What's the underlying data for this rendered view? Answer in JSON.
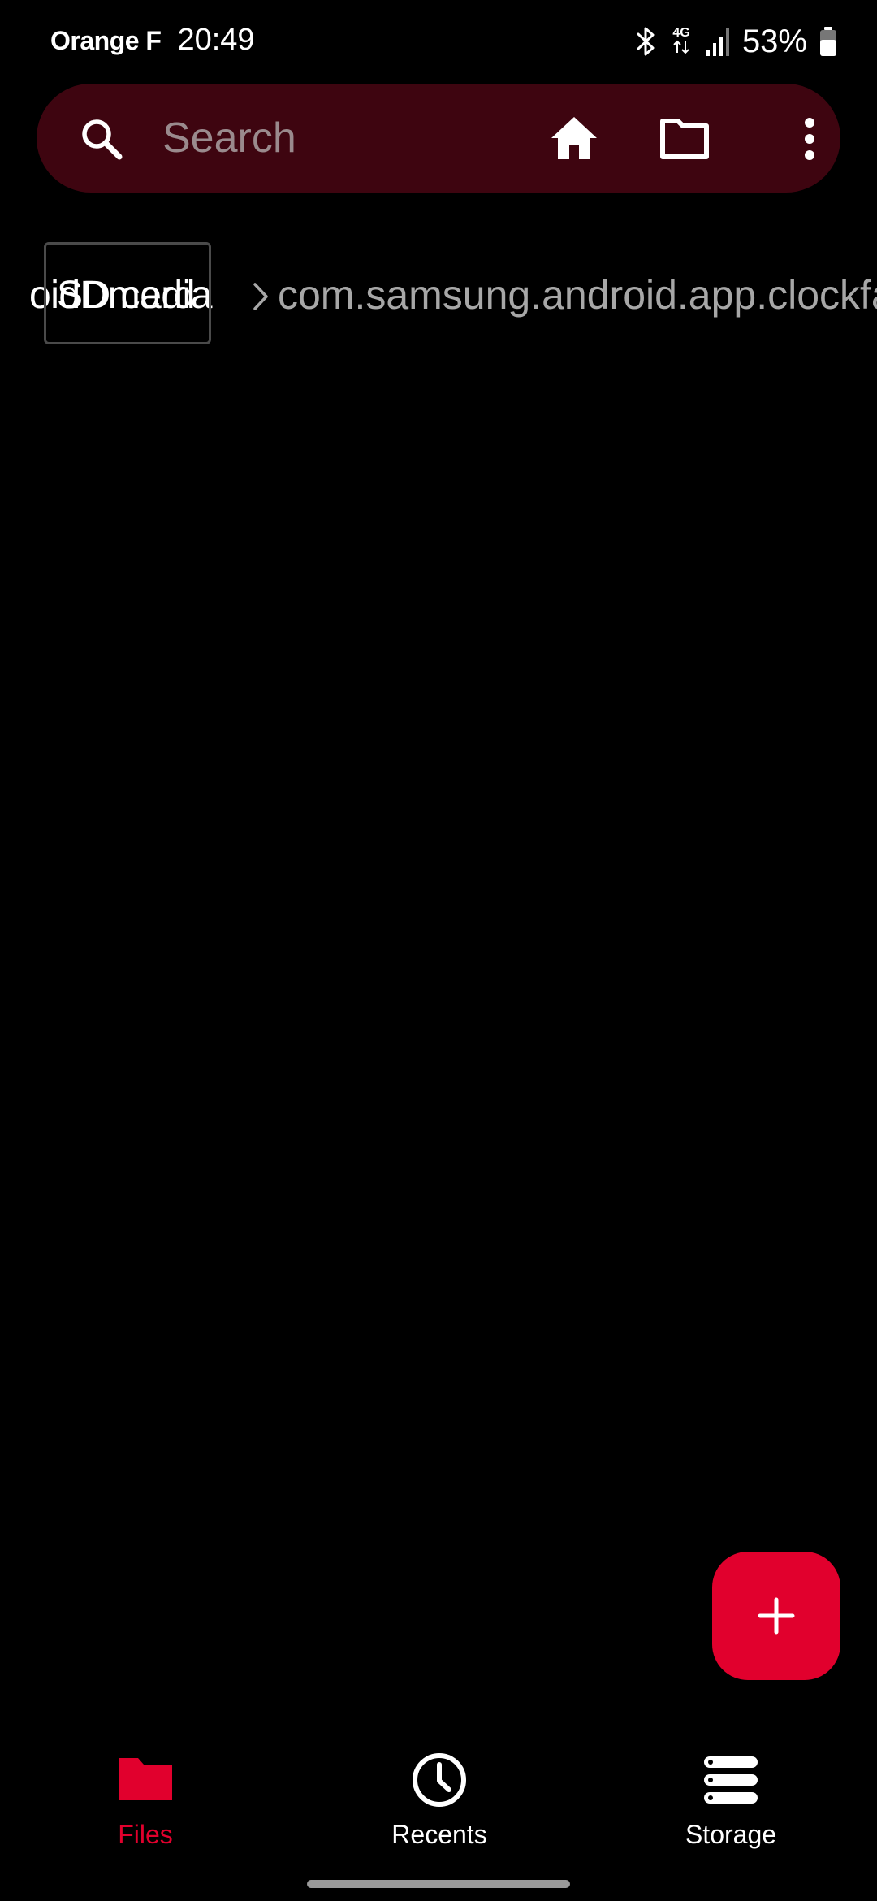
{
  "status_bar": {
    "carrier": "Orange F",
    "time": "20:49",
    "network": "4G",
    "battery": "53%",
    "icons": [
      "bluetooth-icon",
      "4g-data-icon",
      "signal-icon",
      "battery-icon"
    ]
  },
  "search": {
    "placeholder": "Search",
    "value": "",
    "actions": [
      "home-icon",
      "folder-icon",
      "more-vert-icon"
    ]
  },
  "breadcrumb": {
    "ghost_label": "oidDmedia",
    "sd_label": "SD card",
    "path": "com.samsung.android.app.clockface"
  },
  "fab": {
    "icon": "plus-icon"
  },
  "bottom_nav": {
    "items": [
      {
        "label": "Files",
        "icon": "folder-icon",
        "active": true
      },
      {
        "label": "Recents",
        "icon": "clock-icon",
        "active": false
      },
      {
        "label": "Storage",
        "icon": "storage-icon",
        "active": false
      }
    ]
  },
  "colors": {
    "background": "#000000",
    "search_bg": "#3e0510",
    "accent": "#e1002d",
    "muted_text": "#a7a7a7"
  }
}
